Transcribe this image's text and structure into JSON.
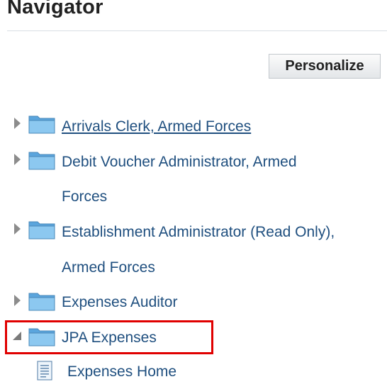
{
  "title": "Navigator",
  "personalize_label": "Personalize",
  "tree": {
    "items": [
      {
        "label": "Arrivals Clerk, Armed Forces",
        "state": "collapsed"
      },
      {
        "label_line1": "Debit Voucher Administrator, Armed",
        "label_line2": "Forces",
        "state": "collapsed"
      },
      {
        "label_line1": "Establishment Administrator (Read Only),",
        "label_line2": "Armed Forces",
        "state": "collapsed"
      },
      {
        "label": "Expenses Auditor",
        "state": "collapsed"
      },
      {
        "label": "JPA Expenses",
        "state": "expanded",
        "highlighted": true
      },
      {
        "label": "Expenses Home",
        "type": "page"
      }
    ]
  },
  "colors": {
    "link": "#1f4f7f",
    "highlight": "#e00000",
    "folder": "#6ab4e8"
  }
}
